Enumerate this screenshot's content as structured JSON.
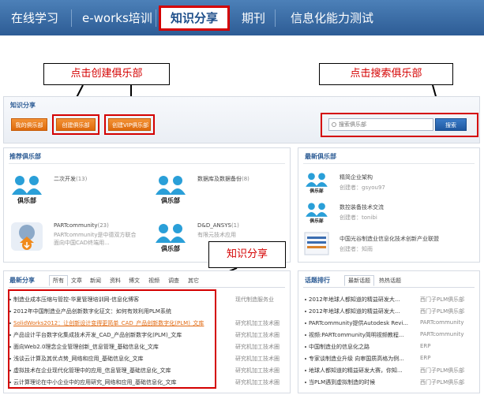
{
  "nav": {
    "items": [
      "在线学习",
      "e-works培训",
      "知识分享",
      "期刊",
      "信息化能力测试"
    ],
    "active_index": 2
  },
  "callouts": {
    "create_club": "点击创建俱乐部",
    "search_club": "点击搜索俱乐部",
    "knowledge_share": "知识分享"
  },
  "knowledge": {
    "title": "知识分享",
    "buttons": {
      "my_club": "我的俱乐部",
      "create_club": "创建俱乐部",
      "create_vip_club": "创建VIP俱乐部"
    },
    "search": {
      "placeholder": "搜索俱乐部",
      "button": "搜索"
    }
  },
  "recommend": {
    "title": "推荐俱乐部",
    "clubs": [
      {
        "name": "二次开发",
        "count": "(13)",
        "desc1": "",
        "desc2": ""
      },
      {
        "name": "数据库及数据备份",
        "count": "(8)",
        "desc1": "",
        "desc2": ""
      },
      {
        "name": "PARTcommunity",
        "count": "(23)",
        "desc1": "PARTcommunity是中德双方联合",
        "desc2": "面向中国CAD终端用..."
      },
      {
        "name": "D&D_ANSYS",
        "count": "(1)",
        "desc1": "有限元技术应用",
        "desc2": ""
      }
    ]
  },
  "newest_clubs": {
    "title": "最新俱乐部",
    "items": [
      {
        "name": "精简企业架构",
        "creator": "创建者：gsyou97"
      },
      {
        "name": "数控装备技术交流",
        "creator": "创建者：tonibi"
      },
      {
        "name": "中国光谷制造业信息化技术创新产业联盟",
        "creator": "创建者：知雨"
      }
    ]
  },
  "latest_share": {
    "title": "最新分享",
    "tabs": [
      "所有",
      "文章",
      "新闻",
      "资料",
      "博文",
      "视频",
      "调查",
      "其它"
    ],
    "rows": [
      {
        "title": "制造业成本压缩与管控-华夏管理培训网-信息化博客",
        "source": "现代制造服务业"
      },
      {
        "title": "2012年中国制造业产品创新数字化征文：如何有效利用PLM系统",
        "source": ""
      },
      {
        "title": "SolidWorks2012：让创新设计变得更简单_CAD_产品创新数字化(PLM)_文库",
        "source": "研究机加工技术圈"
      },
      {
        "title": "产品设计平台数字化集成技术开发_CAD_产品创新数字化(PLM)_文库",
        "source": "研究机加工技术圈"
      },
      {
        "title": "面向Web2.0理念企业管理创新_信息管理_基础信息化_文库",
        "source": "研究机加工技术圈"
      },
      {
        "title": "浅谈云计算及其优点势_网络和应用_基础信息化_文库",
        "source": "研究机加工技术圈"
      },
      {
        "title": "虚拟技术在企业现代化管理中的应用_信息管理_基础信息化_文库",
        "source": "研究机加工技术圈"
      },
      {
        "title": "云计算理论在中小企业中的应用研究_网络和应用_基础信息化_文库",
        "source": "研究机加工技术圈"
      }
    ]
  },
  "topic_rank": {
    "title": "话题排行",
    "tabs": [
      "最新话题",
      "热热话题"
    ],
    "rows": [
      {
        "title": "2012年地球人都知道的精益研发大...",
        "source": "西门子PLM俱乐部"
      },
      {
        "title": "2012年地球人都知道的精益研发大...",
        "source": "西门子PLM俱乐部"
      },
      {
        "title": "PARTcommunity提供Autodesk Revi...",
        "source": "PARTcommunity"
      },
      {
        "title": "视频:PARTcommunity简明视频教程...",
        "source": "PARTcommunity"
      },
      {
        "title": "中国制造业的信息化之路",
        "source": "ERP"
      },
      {
        "title": "专家谈制造业升级 向审国质高格为例...",
        "source": "ERP"
      },
      {
        "title": "地球人都知道的精益研发大赛，你知...",
        "source": "西门子PLM俱乐部"
      },
      {
        "title": "当PLM遇到虚拟制造的时候",
        "source": "西门子PLM俱乐部"
      }
    ]
  }
}
